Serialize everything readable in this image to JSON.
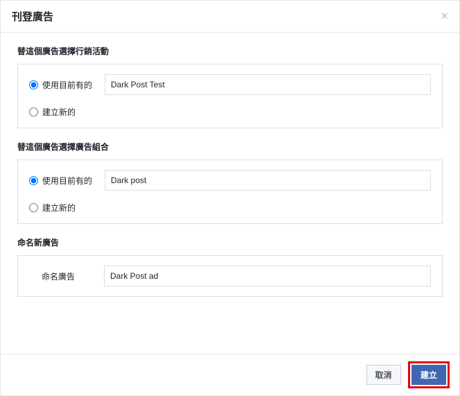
{
  "dialog": {
    "title": "刊登廣告",
    "close_symbol": "×"
  },
  "section1": {
    "title": "替這個廣告選擇行銷活動",
    "radio_existing_label": "使用目前有的",
    "existing_value": "Dark Post Test",
    "radio_new_label": "建立新的"
  },
  "section2": {
    "title": "替這個廣告選擇廣告組合",
    "radio_existing_label": "使用目前有的",
    "existing_value": "Dark post",
    "radio_new_label": "建立新的"
  },
  "section3": {
    "title": "命名新廣告",
    "name_label": "命名廣告",
    "name_value": "Dark Post ad"
  },
  "footer": {
    "cancel": "取消",
    "create": "建立"
  }
}
